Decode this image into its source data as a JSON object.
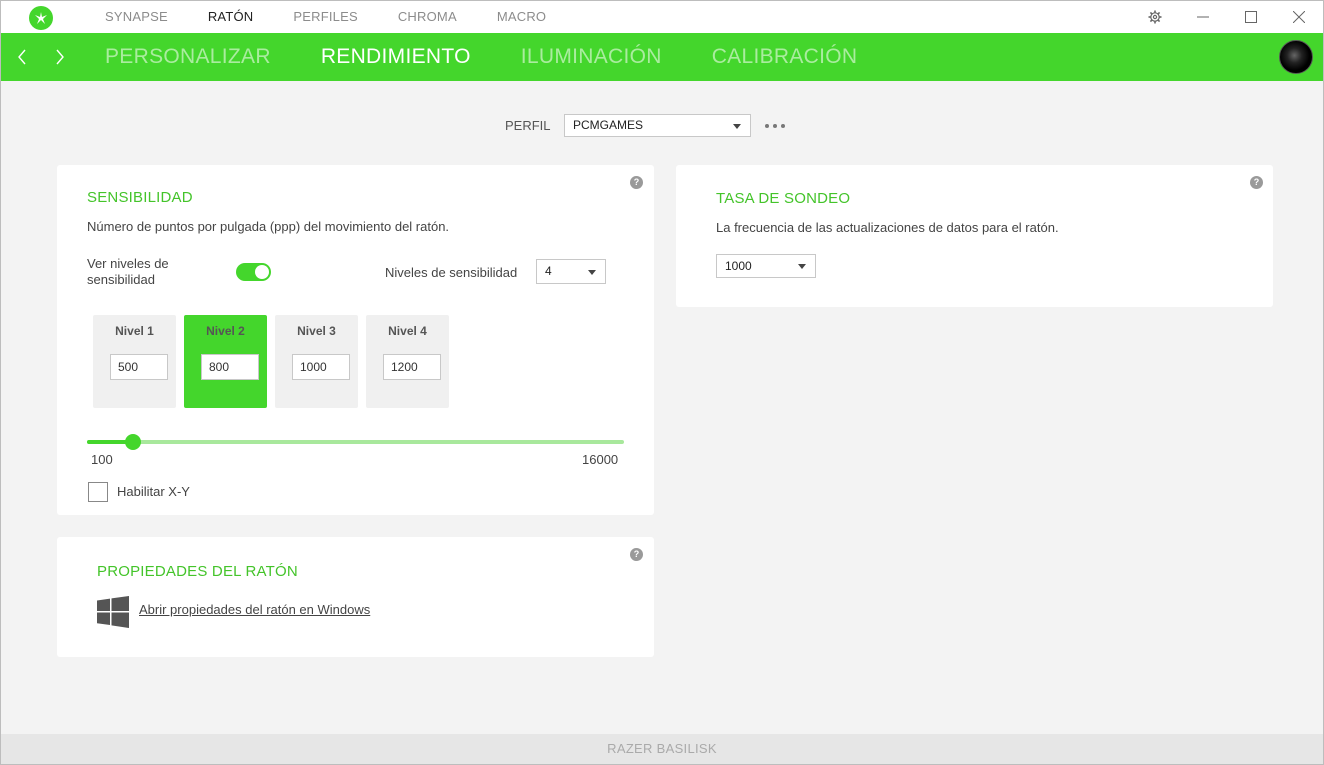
{
  "topnav": {
    "items": [
      "SYNAPSE",
      "RATÓN",
      "PERFILES",
      "CHROMA",
      "MACRO"
    ],
    "active": "RATÓN"
  },
  "subnav": {
    "tabs": [
      "PERSONALIZAR",
      "RENDIMIENTO",
      "ILUMINACIÓN",
      "CALIBRACIÓN"
    ],
    "active": "RENDIMIENTO"
  },
  "profile": {
    "label": "PERFIL",
    "value": "PCMGAMES"
  },
  "sensitivity": {
    "title": "SENSIBILIDAD",
    "description": "Número de puntos por pulgada (ppp) del movimiento del ratón.",
    "show_levels_label_line1": "Ver niveles de",
    "show_levels_label_line2": "sensibilidad",
    "show_levels_enabled": true,
    "levels_count_label": "Niveles de sensibilidad",
    "levels_count_value": "4",
    "levels": [
      {
        "label": "Nivel 1",
        "value": "500"
      },
      {
        "label": "Nivel 2",
        "value": "800"
      },
      {
        "label": "Nivel 3",
        "value": "1000"
      },
      {
        "label": "Nivel 4",
        "value": "1200"
      }
    ],
    "active_level": 2,
    "slider_min": "100",
    "slider_max": "16000",
    "slider_value": 800,
    "xy_label": "Habilitar X-Y",
    "xy_enabled": false
  },
  "polling": {
    "title": "TASA DE SONDEO",
    "description": "La frecuencia de las actualizaciones de datos para el ratón.",
    "value": "1000"
  },
  "mouse_props": {
    "title": "PROPIEDADES DEL RATÓN",
    "link": "Abrir propiedades del ratón en Windows"
  },
  "help_glyph": "?",
  "status": {
    "device": "RAZER BASILISK"
  },
  "colors": {
    "accent": "#44d62c",
    "title_green": "#44c42a"
  }
}
